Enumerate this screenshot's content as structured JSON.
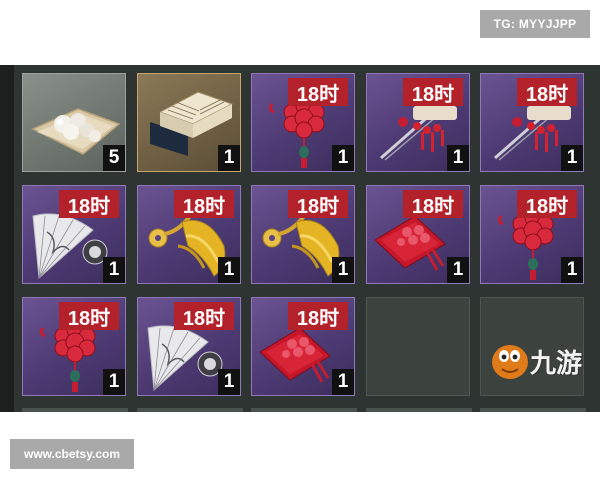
{
  "watermarks": {
    "top_right": "TG: MYYJJPP",
    "bottom_left": "www.cbetsy.com",
    "brand_text": "九游"
  },
  "inventory": {
    "slots": [
      {
        "name": "pearls",
        "rarity": "gray",
        "timer": "",
        "quantity": "5"
      },
      {
        "name": "book",
        "rarity": "gold",
        "timer": "",
        "quantity": "1"
      },
      {
        "name": "chinese-knot",
        "rarity": "purple",
        "timer": "18时",
        "quantity": "1"
      },
      {
        "name": "hairpin",
        "rarity": "purple",
        "timer": "18时",
        "quantity": "1"
      },
      {
        "name": "hairpin",
        "rarity": "purple",
        "timer": "18时",
        "quantity": "1"
      },
      {
        "name": "folding-fan",
        "rarity": "purple",
        "timer": "18时",
        "quantity": "1"
      },
      {
        "name": "gold-tassel",
        "rarity": "purple",
        "timer": "18时",
        "quantity": "1"
      },
      {
        "name": "gold-tassel",
        "rarity": "purple",
        "timer": "18时",
        "quantity": "1"
      },
      {
        "name": "red-pouch",
        "rarity": "purple",
        "timer": "18时",
        "quantity": "1"
      },
      {
        "name": "chinese-knot",
        "rarity": "purple",
        "timer": "18时",
        "quantity": "1"
      },
      {
        "name": "chinese-knot",
        "rarity": "purple",
        "timer": "18时",
        "quantity": "1"
      },
      {
        "name": "folding-fan",
        "rarity": "purple",
        "timer": "18时",
        "quantity": "1"
      },
      {
        "name": "red-pouch",
        "rarity": "purple",
        "timer": "18时",
        "quantity": "1"
      },
      {
        "name": "empty",
        "rarity": "empty",
        "timer": "",
        "quantity": ""
      },
      {
        "name": "empty",
        "rarity": "empty",
        "timer": "",
        "quantity": ""
      }
    ]
  },
  "colors": {
    "timer_badge": "#b3222b",
    "purple_slot": "#5a4580",
    "panel": "#2e3431"
  }
}
